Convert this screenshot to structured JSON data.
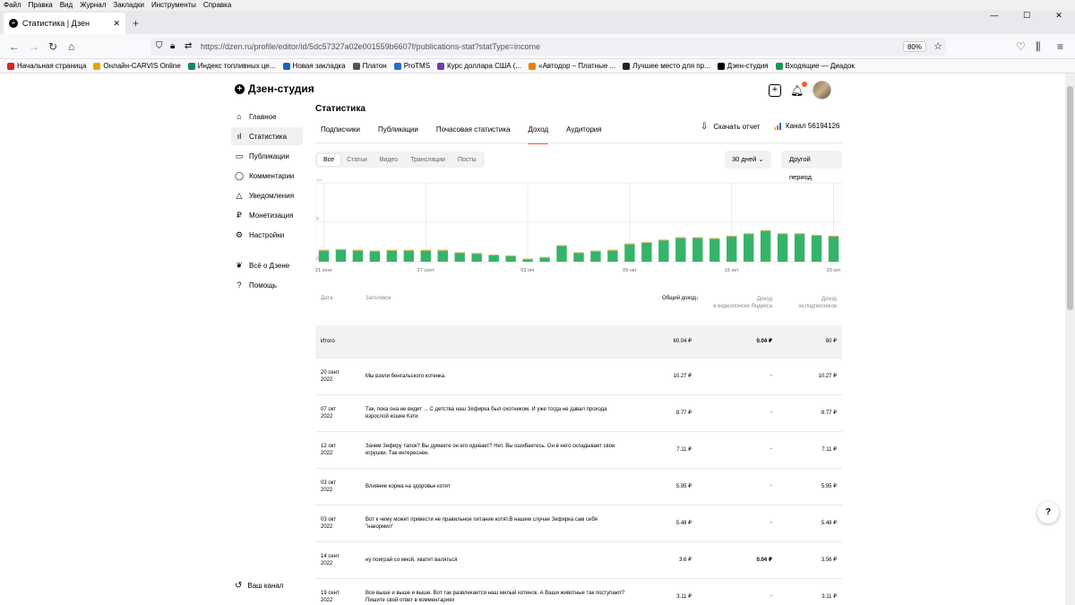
{
  "menubar": [
    "Файл",
    "Правка",
    "Вид",
    "Журнал",
    "Закладки",
    "Инструменты",
    "Справка"
  ],
  "browser": {
    "tab_title": "Статистика | Дзен",
    "url": "https://dzen.ru/profile/editor/id/5dc57327a02e001559b6607f/publications-stat?statType=income",
    "zoom": "80%",
    "bookmarks": [
      {
        "label": "Начальная страница",
        "color": "#d22"
      },
      {
        "label": "Онлайн-CARVIS Online",
        "color": "#e8a500"
      },
      {
        "label": "Индекс топливных це...",
        "color": "#1a8a5a"
      },
      {
        "label": "Новая закладка",
        "color": "#1565c0"
      },
      {
        "label": "Платон",
        "color": "#555"
      },
      {
        "label": "ProTMS",
        "color": "#2a6bd6"
      },
      {
        "label": "Курс доллара США (...",
        "color": "#6a3fb5"
      },
      {
        "label": "«Автодор – Платные ...",
        "color": "#f08000"
      },
      {
        "label": "Лучшее место для пр...",
        "color": "#222"
      },
      {
        "label": "Дзен-студия",
        "color": "#000"
      },
      {
        "label": "Входящие — Диадок",
        "color": "#1a9a5a"
      }
    ]
  },
  "app": {
    "logo": "Дзен-студия",
    "sidebar": [
      {
        "label": "Главное",
        "icon": "home-icon",
        "glyph": "⌂"
      },
      {
        "label": "Статистика",
        "icon": "stats-icon",
        "glyph": "ıl",
        "active": true
      },
      {
        "label": "Публикации",
        "icon": "publications-icon",
        "glyph": "▭"
      },
      {
        "label": "Комментарии",
        "icon": "comments-icon",
        "glyph": "◯"
      },
      {
        "label": "Уведомления",
        "icon": "bell-icon",
        "glyph": "△"
      },
      {
        "label": "Монетизация",
        "icon": "ruble-icon",
        "glyph": "₽"
      },
      {
        "label": "Настройки",
        "icon": "gear-icon",
        "glyph": "⚙"
      },
      {
        "label": "Всё о Дзене",
        "icon": "dzen-icon",
        "glyph": "❦"
      },
      {
        "label": "Помощь",
        "icon": "help-icon",
        "glyph": "?"
      }
    ],
    "bottom_link": "Ваш канал",
    "page_title": "Статистика",
    "tabs": [
      "Подписчики",
      "Публикации",
      "Почасовая статистика",
      "Доход",
      "Аудитория"
    ],
    "active_tab": 3,
    "download": "Скачать отчет",
    "channel": "Канал 56194126",
    "filters": [
      "Все",
      "Статьи",
      "Видео",
      "Трансляции",
      "Посты"
    ],
    "period": "30 дней",
    "other_period": "Другой период"
  },
  "chart_data": {
    "type": "bar",
    "yticks": [
      "10",
      "5",
      "0"
    ],
    "ylim": [
      0,
      10
    ],
    "xticks": [
      "21 сент",
      "27 сент",
      "03 окт",
      "09 окт",
      "15 окт",
      "20 окт"
    ],
    "values": [
      1.5,
      1.6,
      1.5,
      1.4,
      1.5,
      1.5,
      1.5,
      1.5,
      1.2,
      1.1,
      0.9,
      0.8,
      0.4,
      0.6,
      2.1,
      1.2,
      1.4,
      1.5,
      2.3,
      2.5,
      2.8,
      3.1,
      3.1,
      3.0,
      3.3,
      3.6,
      4.0,
      3.6,
      3.6,
      3.4,
      3.3
    ],
    "color": "#36b36a"
  },
  "table": {
    "headers": {
      "date": "Дата",
      "title": "Заголовок",
      "sum": "Общий доход",
      "yandex1": "Доход",
      "yandex2": "в видеопоиске Яндекса",
      "subs1": "Доход",
      "subs2": "за подписчиков"
    },
    "total": {
      "label": "Итого",
      "sum": "60.04 ₽",
      "yandex": "0.04 ₽",
      "subs": "60 ₽"
    },
    "rows": [
      {
        "d1": "20 сент",
        "d2": "2022",
        "title": "Мы взяли бенгальского котенка.",
        "sum": "10.27 ₽",
        "yandex": "-",
        "subs": "10.27 ₽"
      },
      {
        "d1": "07 окт",
        "d2": "2022",
        "title": "Так, пока она не видит ... С детства наш Зефирка был охотником. И уже тогда не давал прохода взрослой кошке Кэти.",
        "sum": "8.77 ₽",
        "yandex": "-",
        "subs": "8.77 ₽"
      },
      {
        "d1": "12 окт",
        "d2": "2022",
        "title": "Зачем Зефиру тапок? Вы думаете он его одевает? Нет. Вы ошибаетесь. Он в него складывает свои игрушки. Так интереснее.",
        "sum": "7.11 ₽",
        "yandex": "-",
        "subs": "7.11 ₽"
      },
      {
        "d1": "03 окт",
        "d2": "2022",
        "title": "Влияние корма на здоровье котят",
        "sum": "5.95 ₽",
        "yandex": "-",
        "subs": "5.95 ₽"
      },
      {
        "d1": "03 окт",
        "d2": "2022",
        "title": "Вот к чему может привести не правильное питание котят.В нашем случае Зефирка сам себя \"накормил\"",
        "sum": "5.48 ₽",
        "yandex": "-",
        "subs": "5.48 ₽"
      },
      {
        "d1": "14 сент",
        "d2": "2022",
        "title": "ну поиграй со мной, хватит валяться",
        "sum": "3.6 ₽",
        "yandex": "0.04 ₽",
        "subs": "3.56 ₽"
      },
      {
        "d1": "19 сент",
        "d2": "2022",
        "title": "Все выше и выше и выше. Вот так развлекается наш милый котенок. А Ваши животные так поступают? Пишите свой ответ в комментариях",
        "sum": "3.11 ₽",
        "yandex": "-",
        "subs": "3.11 ₽"
      }
    ]
  }
}
